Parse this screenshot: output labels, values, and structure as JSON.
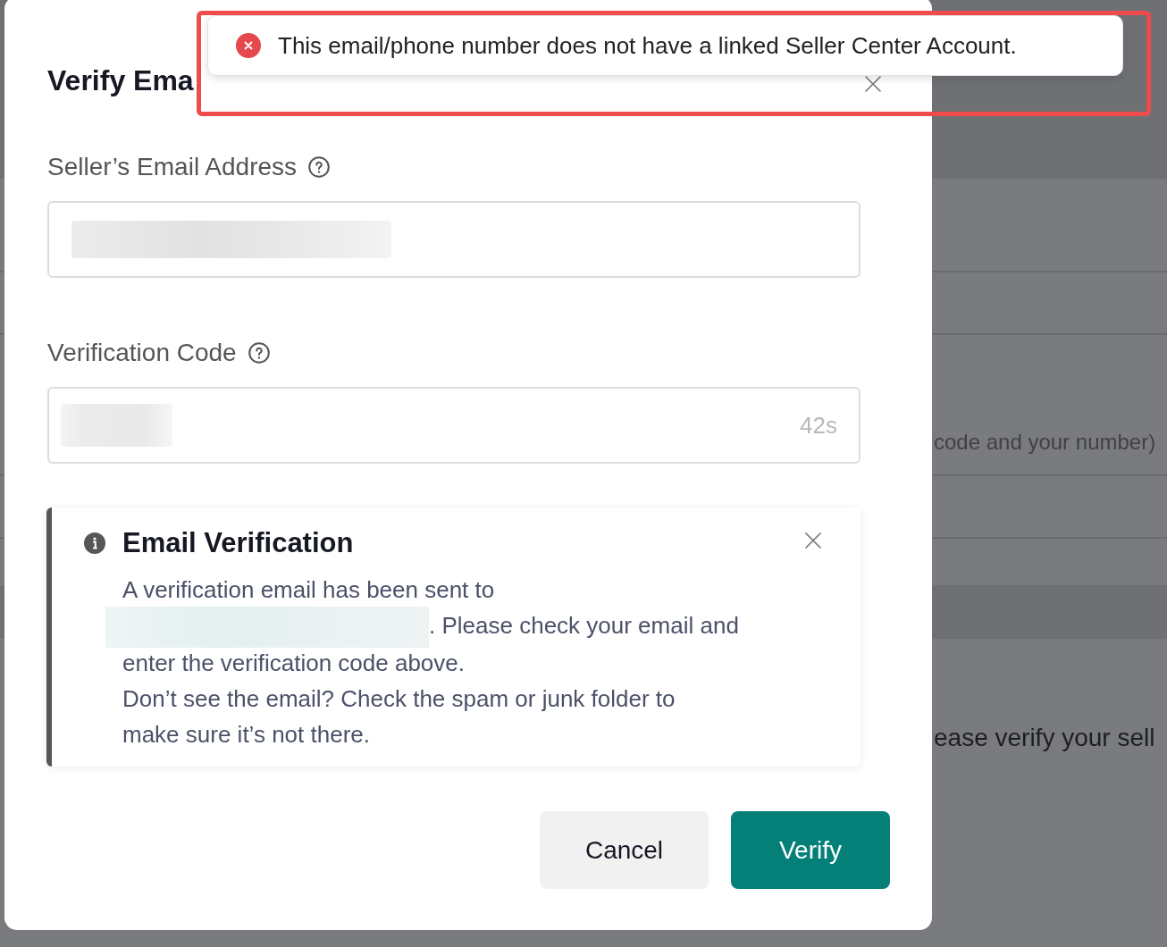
{
  "toast": {
    "kind": "error",
    "message": "This email/phone number does not have a linked Seller Center Account.",
    "highlighted": true
  },
  "dialog": {
    "title": "Verify Ema",
    "fields": [
      {
        "kind": "email",
        "label": "Seller’s Email Address",
        "value_redacted": true
      },
      {
        "kind": "code",
        "label": "Verification Code",
        "value_redacted": true,
        "suffix": "42s"
      }
    ],
    "alert": {
      "kind": "info",
      "title": "Email Verification",
      "message_start": "A verification email has been sent to",
      "email_redacted": true,
      "message_end": ". Please check your email and enter the verification code above.",
      "note": "Don’t see the email? Check the spam or junk folder to make sure it’s not there."
    },
    "buttons": [
      {
        "label": "Cancel",
        "kind": "secondary"
      },
      {
        "label": "Verify",
        "kind": "primary"
      }
    ]
  },
  "background_page": {
    "texts": [
      "code and your number)",
      "ease verify your sell"
    ]
  }
}
